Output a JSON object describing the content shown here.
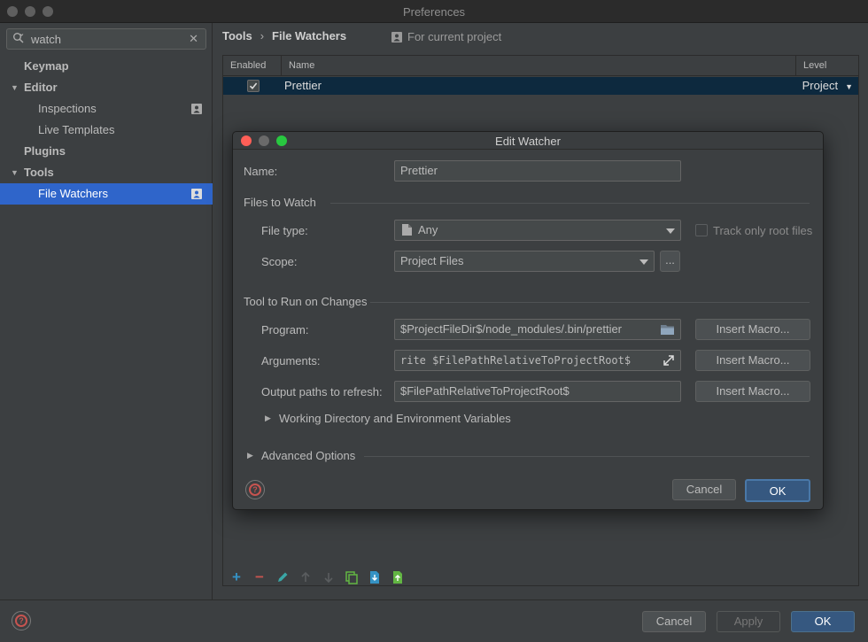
{
  "window": {
    "title": "Preferences"
  },
  "sidebar": {
    "search_value": "watch",
    "items": [
      {
        "label": "Keymap"
      },
      {
        "label": "Editor"
      },
      {
        "label": "Inspections"
      },
      {
        "label": "Live Templates"
      },
      {
        "label": "Plugins"
      },
      {
        "label": "Tools"
      },
      {
        "label": "File Watchers"
      }
    ]
  },
  "header": {
    "breadcrumb_root": "Tools",
    "breadcrumb_sep": "›",
    "breadcrumb_leaf": "File Watchers",
    "scope_note": "For current project"
  },
  "table": {
    "columns": [
      "Enabled",
      "Name",
      "Level"
    ],
    "rows": [
      {
        "enabled": true,
        "name": "Prettier",
        "level": "Project"
      }
    ]
  },
  "dialog": {
    "title": "Edit Watcher",
    "name_label": "Name:",
    "name_value": "Prettier",
    "files_section": "Files to Watch",
    "file_type_label": "File type:",
    "file_type_value": "Any",
    "track_root_label": "Track only root files",
    "scope_label": "Scope:",
    "scope_value": "Project Files",
    "scope_more": "...",
    "tool_section": "Tool to Run on Changes",
    "program_label": "Program:",
    "program_value": "$ProjectFileDir$/node_modules/.bin/prettier",
    "arguments_label": "Arguments:",
    "arguments_value": "rite $FilePathRelativeToProjectRoot$",
    "output_label": "Output paths to refresh:",
    "output_value": "$FilePathRelativeToProjectRoot$",
    "insert_macro": "Insert Macro...",
    "working_dir": "Working Directory and Environment Variables",
    "advanced": "Advanced Options",
    "cancel": "Cancel",
    "ok": "OK"
  },
  "footer": {
    "cancel": "Cancel",
    "apply": "Apply",
    "ok": "OK"
  },
  "colors": {
    "accent": "#2f65ca",
    "primary_button": "#365880",
    "help_red": "#c75450",
    "close_red": "#ff5f57",
    "min_yellow": "#febc2e",
    "max_green": "#28c840"
  }
}
